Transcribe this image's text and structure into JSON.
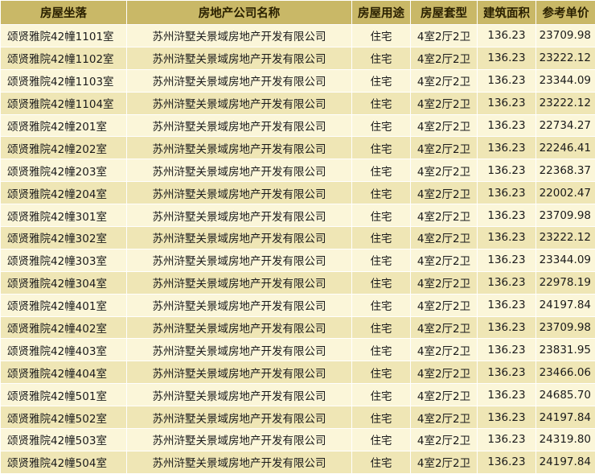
{
  "table": {
    "headers": [
      "房屋坐落",
      "房地产公司名称",
      "房屋用途",
      "房屋套型",
      "建筑面积",
      "参考单价"
    ],
    "rows": [
      [
        "颂贤雅院42幢1101室",
        "苏州浒墅关景域房地产开发有限公司",
        "住宅",
        "4室2厅2卫",
        "136.23",
        "23709.98"
      ],
      [
        "颂贤雅院42幢1102室",
        "苏州浒墅关景域房地产开发有限公司",
        "住宅",
        "4室2厅2卫",
        "136.23",
        "23222.12"
      ],
      [
        "颂贤雅院42幢1103室",
        "苏州浒墅关景域房地产开发有限公司",
        "住宅",
        "4室2厅2卫",
        "136.23",
        "23344.09"
      ],
      [
        "颂贤雅院42幢1104室",
        "苏州浒墅关景域房地产开发有限公司",
        "住宅",
        "4室2厅2卫",
        "136.23",
        "23222.12"
      ],
      [
        "颂贤雅院42幢201室",
        "苏州浒墅关景域房地产开发有限公司",
        "住宅",
        "4室2厅2卫",
        "136.23",
        "22734.27"
      ],
      [
        "颂贤雅院42幢202室",
        "苏州浒墅关景域房地产开发有限公司",
        "住宅",
        "4室2厅2卫",
        "136.23",
        "22246.41"
      ],
      [
        "颂贤雅院42幢203室",
        "苏州浒墅关景域房地产开发有限公司",
        "住宅",
        "4室2厅2卫",
        "136.23",
        "22368.37"
      ],
      [
        "颂贤雅院42幢204室",
        "苏州浒墅关景域房地产开发有限公司",
        "住宅",
        "4室2厅2卫",
        "136.23",
        "22002.47"
      ],
      [
        "颂贤雅院42幢301室",
        "苏州浒墅关景域房地产开发有限公司",
        "住宅",
        "4室2厅2卫",
        "136.23",
        "23709.98"
      ],
      [
        "颂贤雅院42幢302室",
        "苏州浒墅关景域房地产开发有限公司",
        "住宅",
        "4室2厅2卫",
        "136.23",
        "23222.12"
      ],
      [
        "颂贤雅院42幢303室",
        "苏州浒墅关景域房地产开发有限公司",
        "住宅",
        "4室2厅2卫",
        "136.23",
        "23344.09"
      ],
      [
        "颂贤雅院42幢304室",
        "苏州浒墅关景域房地产开发有限公司",
        "住宅",
        "4室2厅2卫",
        "136.23",
        "22978.19"
      ],
      [
        "颂贤雅院42幢401室",
        "苏州浒墅关景域房地产开发有限公司",
        "住宅",
        "4室2厅2卫",
        "136.23",
        "24197.84"
      ],
      [
        "颂贤雅院42幢402室",
        "苏州浒墅关景域房地产开发有限公司",
        "住宅",
        "4室2厅2卫",
        "136.23",
        "23709.98"
      ],
      [
        "颂贤雅院42幢403室",
        "苏州浒墅关景域房地产开发有限公司",
        "住宅",
        "4室2厅2卫",
        "136.23",
        "23831.95"
      ],
      [
        "颂贤雅院42幢404室",
        "苏州浒墅关景域房地产开发有限公司",
        "住宅",
        "4室2厅2卫",
        "136.23",
        "23466.06"
      ],
      [
        "颂贤雅院42幢501室",
        "苏州浒墅关景域房地产开发有限公司",
        "住宅",
        "4室2厅2卫",
        "136.23",
        "24685.70"
      ],
      [
        "颂贤雅院42幢502室",
        "苏州浒墅关景域房地产开发有限公司",
        "住宅",
        "4室2厅2卫",
        "136.23",
        "24197.84"
      ],
      [
        "颂贤雅院42幢503室",
        "苏州浒墅关景域房地产开发有限公司",
        "住宅",
        "4室2厅2卫",
        "136.23",
        "24319.80"
      ],
      [
        "颂贤雅院42幢504室",
        "苏州浒墅关景域房地产开发有限公司",
        "住宅",
        "4室2厅2卫",
        "136.23",
        "24197.84"
      ]
    ]
  },
  "colors": {
    "header_bg": "#c9b867",
    "row_light": "#fbf6d9",
    "row_dark": "#efe6b5"
  }
}
